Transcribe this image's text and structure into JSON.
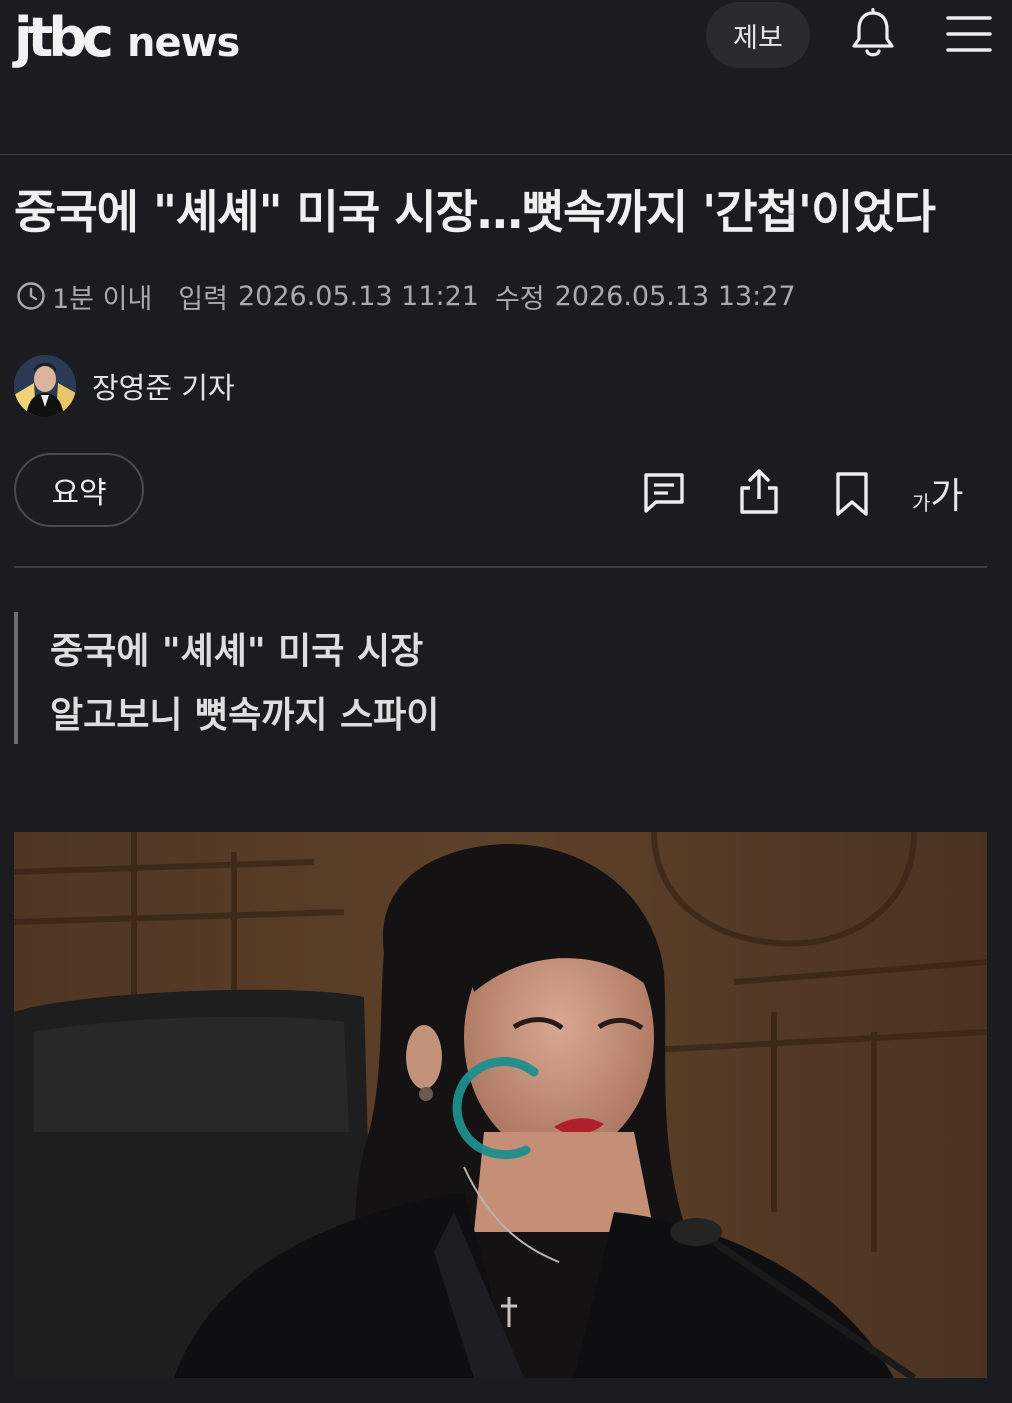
{
  "header": {
    "logo_main": "jtbc",
    "logo_sub": "news",
    "report_label": "제보",
    "bell_icon": "bell-icon",
    "menu_icon": "hamburger-menu-icon"
  },
  "article": {
    "title": "중국에 \"셰셰\" 미국 시장…뼛속까지 '간첩'이었다",
    "read_time": "1분 이내",
    "published_label": "입력",
    "published": "2026.05.13 11:21",
    "modified_label": "수정",
    "modified": "2026.05.13 13:27",
    "author": "장영준 기자",
    "subheadline": [
      "중국에 \"셰셰\" 미국 시장",
      "알고보니 뼛속까지 스파이"
    ]
  },
  "toolbar": {
    "summary_label": "요약",
    "font_small": "가",
    "font_large": "가",
    "icons": [
      "comment-icon",
      "share-icon",
      "bookmark-icon"
    ]
  },
  "colors": {
    "background": "#1b1c1f",
    "text": "#f0f0f0",
    "muted": "#a9aaad",
    "spinner": "#1f8f8c"
  }
}
